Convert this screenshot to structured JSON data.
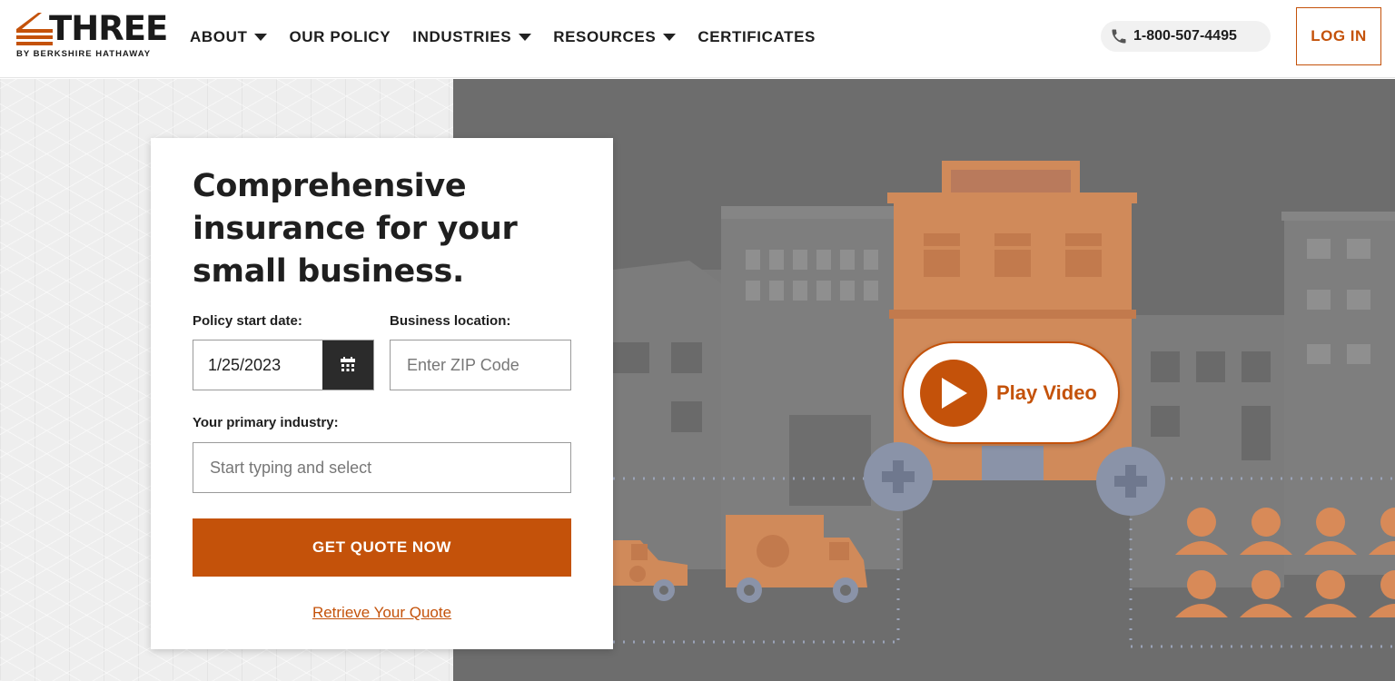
{
  "brand": {
    "name": "THREE",
    "tagline": "BY BERKSHIRE HATHAWAY",
    "accent": "#c4520a",
    "dark": "#1f1f1f"
  },
  "nav": {
    "items": [
      {
        "label": "ABOUT",
        "has_dropdown": true
      },
      {
        "label": "OUR POLICY",
        "has_dropdown": false
      },
      {
        "label": "INDUSTRIES",
        "has_dropdown": true
      },
      {
        "label": "RESOURCES",
        "has_dropdown": true
      },
      {
        "label": "CERTIFICATES",
        "has_dropdown": false
      }
    ],
    "phone": "1-800-507-4495",
    "phone_icon": "phone-icon",
    "login": "LOG IN"
  },
  "form": {
    "title": "Comprehensive insurance for your small business.",
    "start_date_label": "Policy start date:",
    "start_date_value": "1/25/2023",
    "calendar_icon": "calendar-icon",
    "location_label": "Business location:",
    "zip_placeholder": "Enter ZIP Code",
    "industry_label": "Your primary industry:",
    "industry_placeholder": "Start typing and select",
    "submit": "GET QUOTE NOW",
    "retrieve": "Retrieve Your Quote"
  },
  "hero": {
    "play_label": "Play Video",
    "play_icon": "play-icon"
  }
}
